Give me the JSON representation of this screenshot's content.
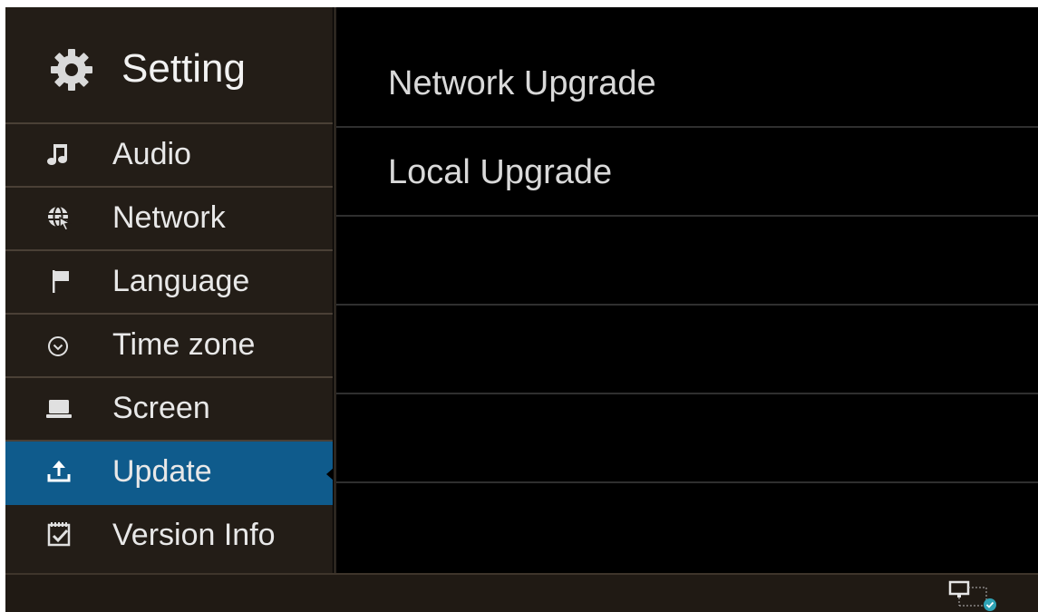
{
  "sidebar": {
    "title": "Setting",
    "header_icon": "gear-icon",
    "items": [
      {
        "label": "Audio",
        "icon": "music-note-icon"
      },
      {
        "label": "Network",
        "icon": "globe-cursor-icon"
      },
      {
        "label": "Language",
        "icon": "flag-icon"
      },
      {
        "label": "Time zone",
        "icon": "clock-icon"
      },
      {
        "label": "Screen",
        "icon": "laptop-icon"
      },
      {
        "label": "Update",
        "icon": "upload-icon",
        "selected": true
      },
      {
        "label": "Version Info",
        "icon": "checklist-icon"
      }
    ]
  },
  "content": {
    "options": [
      {
        "label": "Network Upgrade"
      },
      {
        "label": "Local Upgrade"
      },
      {
        "label": ""
      },
      {
        "label": ""
      },
      {
        "label": ""
      }
    ]
  },
  "status_bar": {
    "network_icon": "network-connected-icon"
  },
  "colors": {
    "accent": "#0f5b8c",
    "sidebar_bg": "#231d17",
    "content_bg": "#000000"
  }
}
